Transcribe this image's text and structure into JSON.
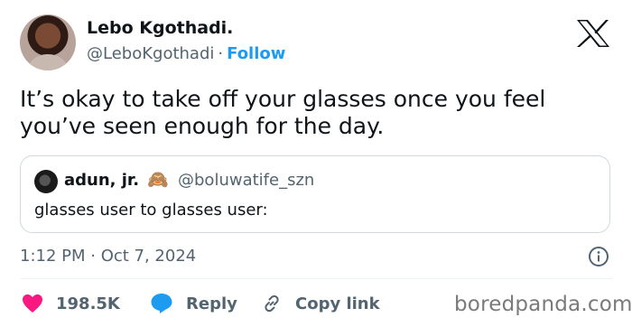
{
  "author": {
    "name": "Lebo Kgothadi.",
    "handle": "@LeboKgothadi",
    "separator": "·",
    "follow_label": "Follow"
  },
  "tweet": {
    "lines": [
      "It’s okay to take off your glasses once you feel",
      "you’ve seen enough for the day."
    ]
  },
  "quote": {
    "name": "adun, jr.",
    "emoji": "🙈",
    "handle": "@boluwatife_szn",
    "text": "glasses user to glasses user:"
  },
  "timestamp": "1:12 PM · Oct 7, 2024",
  "actions": {
    "like_count": "198.5K",
    "reply_label": "Reply",
    "copy_link_label": "Copy link"
  },
  "watermark": "boredpanda.com",
  "colors": {
    "accent": "#1d9bf0",
    "heart": "#f91880",
    "secondary_text": "#536471",
    "border": "#cfd9de"
  },
  "icons": [
    "x-logo-icon",
    "info-icon",
    "heart-icon",
    "reply-bubble-icon",
    "link-icon"
  ]
}
